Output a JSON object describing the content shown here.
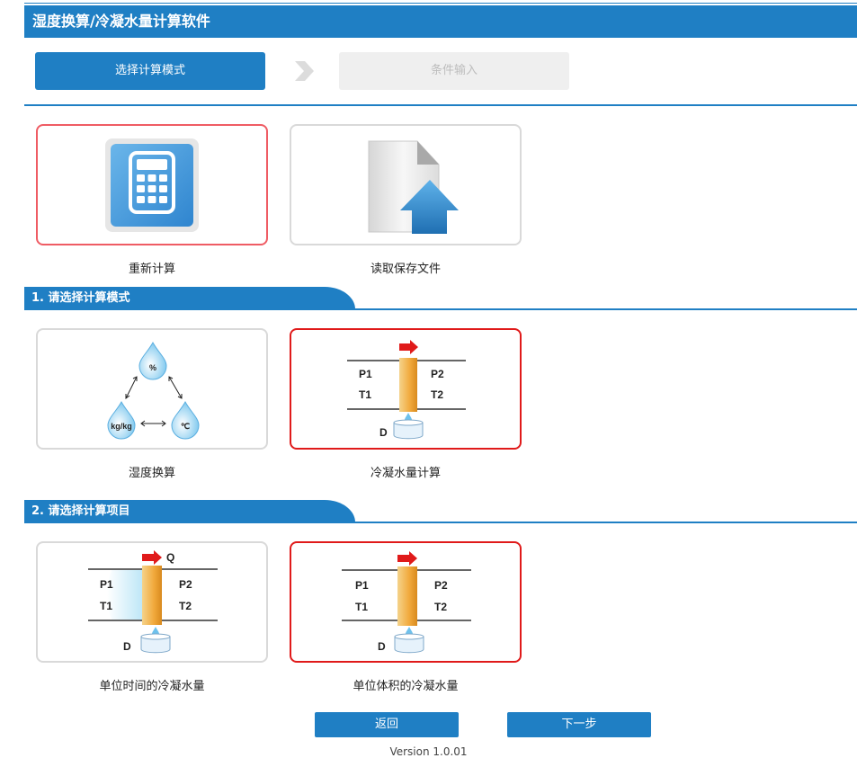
{
  "app": {
    "title": "湿度换算/冷凝水量计算软件"
  },
  "steps": {
    "step1": "选择计算模式",
    "step2": "条件输入"
  },
  "file_options": [
    {
      "label": "重新计算",
      "icon": "calculator-icon",
      "selected": true
    },
    {
      "label": "读取保存文件",
      "icon": "open-file-icon",
      "selected": false
    }
  ],
  "sections": {
    "mode": {
      "title": "1. 请选择计算模式",
      "options": [
        {
          "label": "湿度换算",
          "selected": false
        },
        {
          "label": "冷凝水量计算",
          "selected": true
        }
      ]
    },
    "item": {
      "title": "2. 请选择计算项目",
      "options": [
        {
          "label": "单位时间的冷凝水量",
          "selected": false
        },
        {
          "label": "单位体积的冷凝水量",
          "selected": true
        }
      ]
    }
  },
  "diagram_labels": {
    "p1": "P1",
    "t1": "T1",
    "p2": "P2",
    "t2": "T2",
    "d": "D",
    "q": "Q",
    "percent": "%",
    "kgkg": "kg/kg",
    "celsius": "℃"
  },
  "buttons": {
    "back": "返回",
    "next": "下一步"
  },
  "footer": {
    "version": "Version 1.0.01"
  },
  "colors": {
    "accent": "#1f7fc4",
    "selected_pink": "#ef5c64",
    "selected_red": "#e01a1a"
  }
}
